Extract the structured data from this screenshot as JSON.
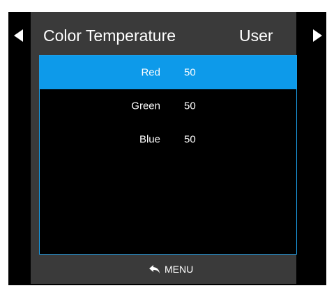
{
  "header": {
    "title": "Color Temperature",
    "mode": "User"
  },
  "items": [
    {
      "label": "Red",
      "value": "50",
      "selected": true
    },
    {
      "label": "Green",
      "value": "50",
      "selected": false
    },
    {
      "label": "Blue",
      "value": "50",
      "selected": false
    }
  ],
  "footer": {
    "icon": "return-arrow-icon",
    "label": "MENU"
  },
  "colors": {
    "accent": "#0d9aea",
    "panel": "#3a3a3a",
    "background": "#000000"
  }
}
